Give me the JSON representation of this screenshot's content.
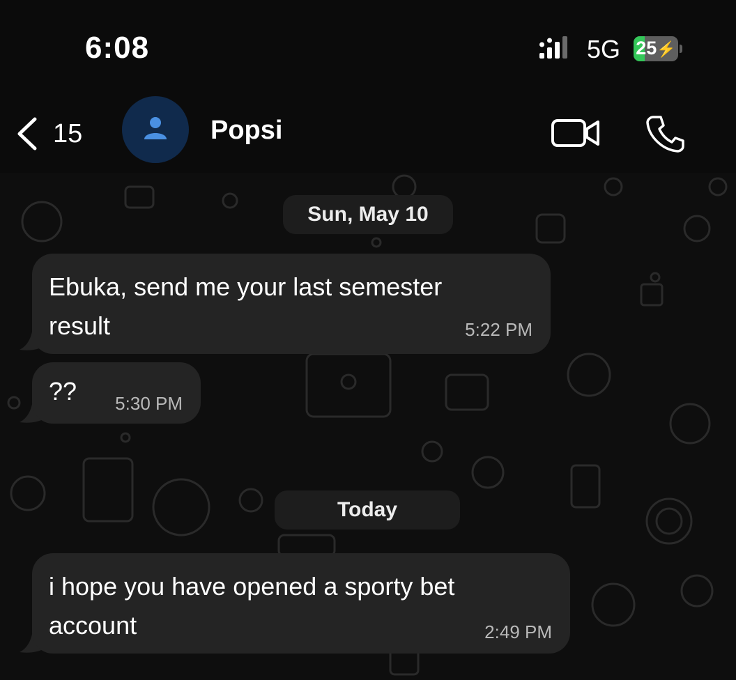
{
  "status_bar": {
    "time": "6:08",
    "network": "5G",
    "battery_level": "25",
    "battery_percent": 25,
    "charging": true
  },
  "header": {
    "back_count": "15",
    "contact_name": "Popsi",
    "icons": [
      "chevron-left-icon",
      "person-icon",
      "video-call-icon",
      "phone-icon"
    ]
  },
  "chat": {
    "date_separators": [
      "Sun, May 10",
      "Today"
    ],
    "messages": [
      {
        "line1": "Ebuka, send me your last semester",
        "line2": "result",
        "time": "5:22 PM",
        "direction": "incoming"
      },
      {
        "text": "??",
        "time": "5:30 PM",
        "direction": "incoming"
      },
      {
        "line1": "i hope you have opened a sporty bet",
        "line2": "account",
        "time": "2:49 PM",
        "direction": "incoming"
      }
    ]
  },
  "colors": {
    "background": "#0b0b0b",
    "bubble": "#242424",
    "battery_green": "#34c759",
    "avatar_bg": "#102a4c",
    "avatar_icon": "#4a90e2"
  }
}
